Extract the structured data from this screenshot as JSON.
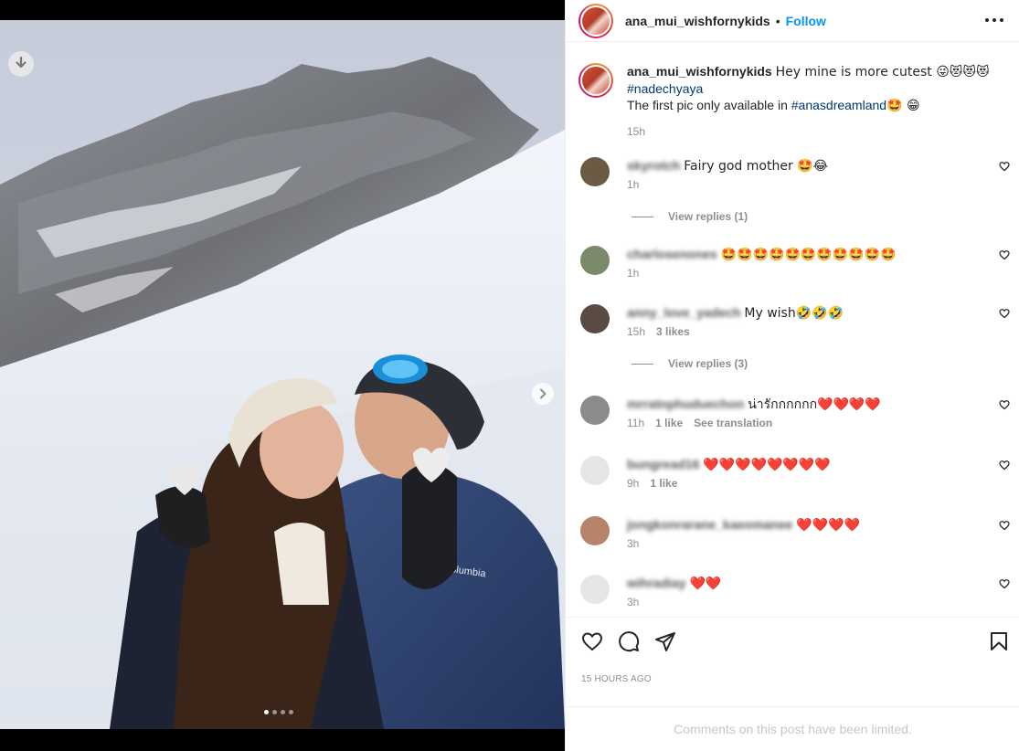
{
  "post": {
    "username": "ana_mui_wishfornykids",
    "separator": "•",
    "follow_label": "Follow",
    "caption_text": "Hey mine is more cutest 😜😻😻😻",
    "caption_tag1": "#nadechyaya",
    "caption_line3_prefix": "The first pic only available in ",
    "caption_tag2": "#anasdreamland",
    "caption_line3_suffix": "🤩 😁",
    "caption_time": "15h",
    "posted_time": "15 hours ago",
    "comments_limited": "Comments on this post have been limited.",
    "carousel_count": 4,
    "carousel_active_index": 0
  },
  "comments": [
    {
      "user": "skyrotch",
      "text": "Fairy god mother 🤩😂",
      "time": "1h",
      "likes": "",
      "extra": "",
      "replies": "View replies (1)"
    },
    {
      "user": "charlosenones",
      "text": "🤩🤩🤩🤩🤩🤩🤩🤩🤩🤩🤩",
      "time": "1h",
      "likes": "",
      "extra": "",
      "replies": ""
    },
    {
      "user": "anny_love_yadech",
      "text": "My wish🤣🤣🤣",
      "time": "15h",
      "likes": "3 likes",
      "extra": "",
      "replies": "View replies (3)"
    },
    {
      "user": "mrratnphuduechon",
      "text": "น่ารักกกกกก❤️❤️❤️❤️",
      "time": "11h",
      "likes": "1 like",
      "extra": "See translation",
      "replies": ""
    },
    {
      "user": "bungread16",
      "text": "❤️❤️❤️❤️❤️❤️❤️❤️",
      "time": "9h",
      "likes": "1 like",
      "extra": "",
      "replies": ""
    },
    {
      "user": "jongkonrarane_kaeomanee",
      "text": "❤️❤️❤️❤️",
      "time": "3h",
      "likes": "",
      "extra": "",
      "replies": ""
    },
    {
      "user": "wihradiay",
      "text": "❤️❤️",
      "time": "3h",
      "likes": "",
      "extra": "",
      "replies": ""
    }
  ],
  "icons": {
    "download": "download-icon",
    "next": "chevron-right-icon",
    "more": "more-options-icon",
    "like": "heart-icon",
    "comment": "comment-icon",
    "share": "paper-plane-icon",
    "save": "bookmark-icon"
  },
  "colors": {
    "accent": "#0095f6",
    "hashtag": "#00376b",
    "muted": "#8e8e8e"
  }
}
